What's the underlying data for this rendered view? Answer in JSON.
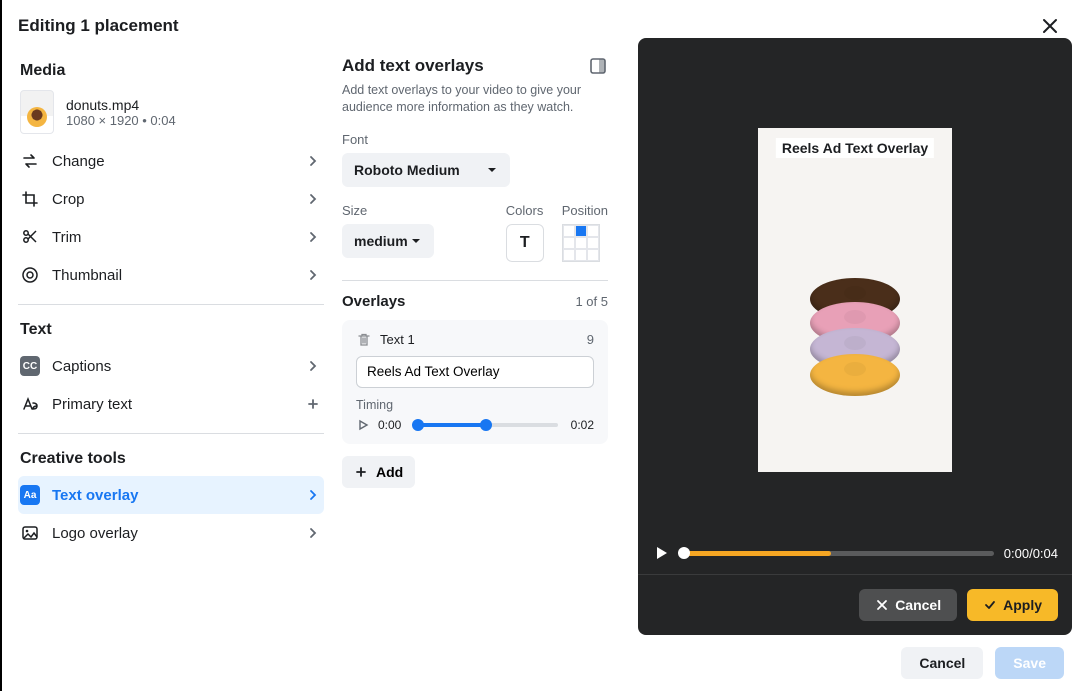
{
  "header": {
    "title": "Editing 1 placement"
  },
  "media": {
    "section_label": "Media",
    "filename": "donuts.mp4",
    "meta": "1080 × 1920 • 0:04",
    "rows": {
      "change": "Change",
      "crop": "Crop",
      "trim": "Trim",
      "thumbnail": "Thumbnail"
    }
  },
  "text_section": {
    "label": "Text",
    "captions": "Captions",
    "primary_text": "Primary text"
  },
  "creative_tools": {
    "label": "Creative tools",
    "text_overlay": "Text overlay",
    "logo_overlay": "Logo overlay"
  },
  "overlay_panel": {
    "title": "Add text overlays",
    "description": "Add text overlays to your video to give your audience more information as they watch.",
    "font_label": "Font",
    "font_value": "Roboto Medium",
    "size_label": "Size",
    "size_value": "medium",
    "colors_label": "Colors",
    "position_label": "Position",
    "overlays_label": "Overlays",
    "overlays_count": "1 of 5",
    "item_name": "Text 1",
    "char_count": "9",
    "text_value": "Reels Ad Text Overlay",
    "timing_label": "Timing",
    "timing_start": "0:00",
    "timing_end": "0:02",
    "add_label": "Add"
  },
  "preview": {
    "overlay_text": "Reels Ad Text Overlay",
    "scrub_time": "0:00/0:04",
    "cancel": "Cancel",
    "apply": "Apply"
  },
  "footer": {
    "cancel": "Cancel",
    "save": "Save"
  }
}
